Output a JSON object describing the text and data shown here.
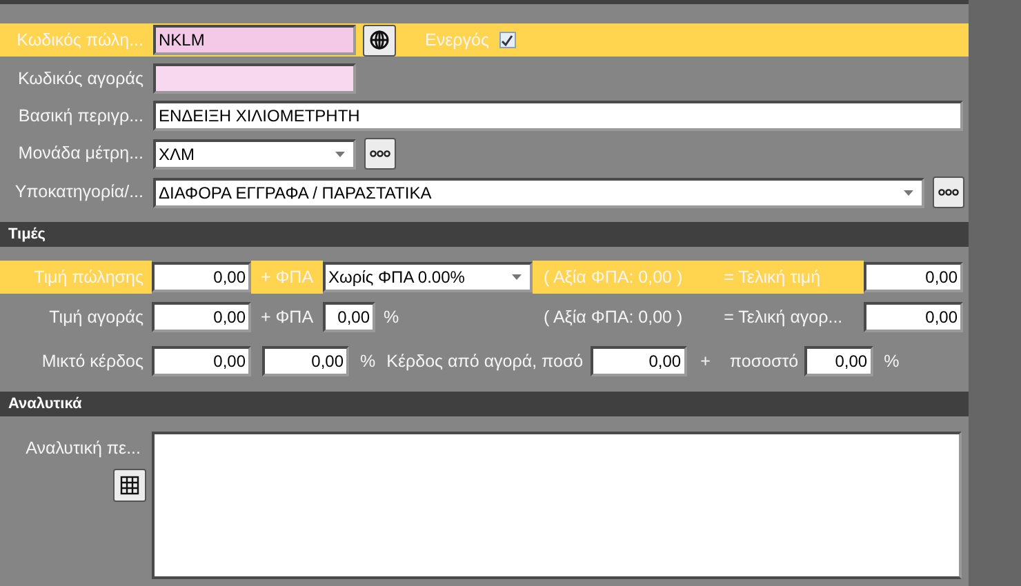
{
  "general": {
    "sales_code": {
      "label": "Κωδικός πώλη...",
      "value": "NKLM",
      "highlighted": true
    },
    "active": {
      "label": "Ενεργός",
      "checked": true
    },
    "purchase_code": {
      "label": "Κωδικός αγοράς"
    },
    "description": {
      "label": "Βασική περιγρ...",
      "value": "ΕΝΔΕΙΞΗ ΧΙΛΙΟΜΕΤΡΗΤΗ"
    },
    "unit": {
      "label": "Μονάδα μέτρη...",
      "value": "ΧΛΜ"
    },
    "subcategory": {
      "label": "Υποκατηγορία/...",
      "value": "ΔΙΑΦΟΡΑ ΕΓΓΡΑΦΑ / ΠΑΡΑΣΤΑΤΙΚΑ"
    }
  },
  "prices": {
    "title": "Τιμές",
    "sale": {
      "label": "Τιμή πώλησης",
      "highlighted": true,
      "price": "0,00",
      "vat_label": "+ ΦΠΑ",
      "vat": "Χωρίς ΦΠΑ 0.00%",
      "vat_amount": "( Αξία ΦΠΑ: 0,00 )",
      "total_label": "= Τελική τιμή",
      "total": "0,00"
    },
    "purchase": {
      "label": "Τιμή αγοράς",
      "highlighted": false,
      "price": "0,00",
      "vat_label": "+ ΦΠΑ",
      "vat": "0,00",
      "vat_percent": "%",
      "vat_amount": "( Αξία ΦΠΑ: 0,00 )",
      "total_label": "= Τελική αγορ...",
      "total": "0,00"
    },
    "profit": {
      "label": "Μικτό κέρδος",
      "amount": "0,00",
      "percent_value": "0,00",
      "percent": "%",
      "from_purchase_label": "Κέρδος από αγορά, ποσό",
      "from_purchase_amount": "0,00",
      "plus": "+",
      "rate_label": "ποσοστό",
      "rate": "0,00",
      "rate_percent": "%"
    }
  },
  "details": {
    "title": "Αναλυτικά",
    "label": "Αναλυτική πε..."
  }
}
